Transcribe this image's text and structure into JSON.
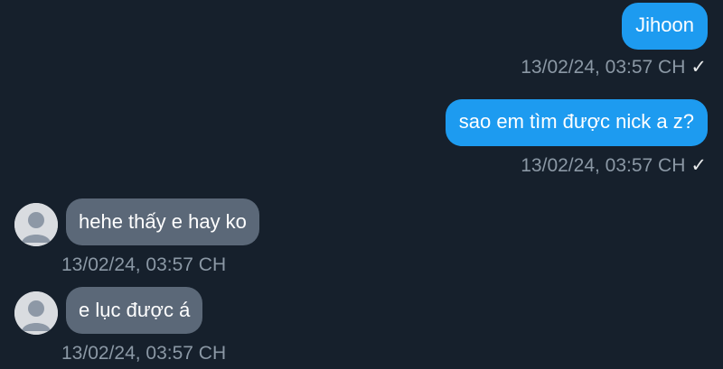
{
  "messages": [
    {
      "direction": "outgoing",
      "text": "Jihoon",
      "time": "13/02/24, 03:57 CH",
      "status": "sent-check-icon"
    },
    {
      "direction": "outgoing",
      "text": "sao em tìm được nick a z?",
      "time": "13/02/24, 03:57 CH",
      "status": "sent-check-icon"
    },
    {
      "direction": "incoming",
      "text": "hehe thấy e hay ko",
      "time": "13/02/24, 03:57 CH"
    },
    {
      "direction": "incoming",
      "text": "e lục được á",
      "time": "13/02/24, 03:57 CH"
    }
  ],
  "check_glyph": "✓",
  "colors": {
    "background": "#16202c",
    "outgoing_bubble": "#1d9bf0",
    "incoming_bubble": "#5b6878",
    "timestamp": "#8b98a5"
  }
}
